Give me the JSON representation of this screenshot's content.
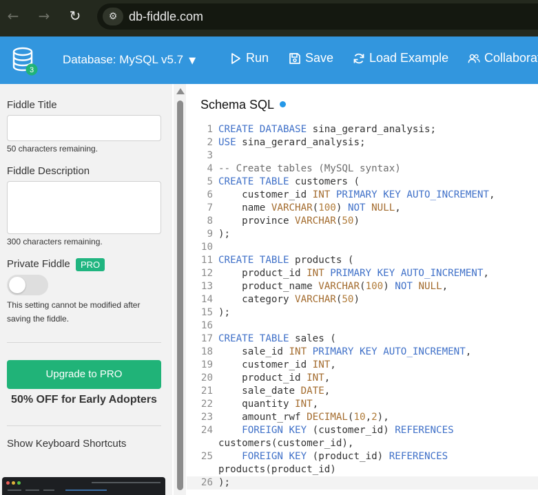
{
  "browser": {
    "url": "db-fiddle.com",
    "back_icon": "←",
    "forward_icon": "→",
    "reload_icon": "↻"
  },
  "header": {
    "badge_count": "3",
    "database_label": "Database: MySQL v5.7",
    "caret": "▼",
    "run_label": "Run",
    "save_label": "Save",
    "load_example_label": "Load Example",
    "collaborate_label": "Collaborat",
    "accent_color": "#3296de"
  },
  "sidebar": {
    "title_label": "Fiddle Title",
    "title_value": "",
    "title_remaining": "50 characters remaining.",
    "description_label": "Fiddle Description",
    "description_value": "",
    "description_remaining": "300 characters remaining.",
    "private_label": "Private Fiddle",
    "pro_badge": "PRO",
    "private_enabled": false,
    "private_note": "This setting cannot be modified after saving the fiddle.",
    "upgrade_label": "Upgrade to PRO",
    "offer_text": "50% OFF for Early Adopters",
    "shortcuts_label": "Show Keyboard Shortcuts",
    "pro_color": "#20b580"
  },
  "editor": {
    "title": "Schema SQL",
    "active_line": "26",
    "lines": [
      {
        "num": "1",
        "tokens": [
          [
            "k",
            "CREATE"
          ],
          [
            "p",
            " "
          ],
          [
            "k",
            "DATABASE"
          ],
          [
            "p",
            " sina_gerard_analysis;"
          ]
        ]
      },
      {
        "num": "2",
        "tokens": [
          [
            "k",
            "USE"
          ],
          [
            "p",
            " sina_gerard_analysis;"
          ]
        ]
      },
      {
        "num": "3",
        "tokens": []
      },
      {
        "num": "4",
        "tokens": [
          [
            "c",
            "-- Create tables (MySQL syntax)"
          ]
        ]
      },
      {
        "num": "5",
        "tokens": [
          [
            "k",
            "CREATE"
          ],
          [
            "p",
            " "
          ],
          [
            "k",
            "TABLE"
          ],
          [
            "p",
            " customers ("
          ]
        ]
      },
      {
        "num": "6",
        "tokens": [
          [
            "p",
            "    customer_id "
          ],
          [
            "t",
            "INT"
          ],
          [
            "p",
            " "
          ],
          [
            "k",
            "PRIMARY"
          ],
          [
            "p",
            " "
          ],
          [
            "k",
            "KEY"
          ],
          [
            "p",
            " "
          ],
          [
            "k",
            "AUTO_INCREMENT"
          ],
          [
            "p",
            ","
          ]
        ]
      },
      {
        "num": "7",
        "tokens": [
          [
            "p",
            "    name "
          ],
          [
            "t",
            "VARCHAR"
          ],
          [
            "p",
            "("
          ],
          [
            "n",
            "100"
          ],
          [
            "p",
            ") "
          ],
          [
            "k",
            "NOT"
          ],
          [
            "p",
            " "
          ],
          [
            "t",
            "NULL"
          ],
          [
            "p",
            ","
          ]
        ]
      },
      {
        "num": "8",
        "tokens": [
          [
            "p",
            "    province "
          ],
          [
            "t",
            "VARCHAR"
          ],
          [
            "p",
            "("
          ],
          [
            "n",
            "50"
          ],
          [
            "p",
            ")"
          ]
        ]
      },
      {
        "num": "9",
        "tokens": [
          [
            "p",
            ");"
          ]
        ]
      },
      {
        "num": "10",
        "tokens": []
      },
      {
        "num": "11",
        "tokens": [
          [
            "k",
            "CREATE"
          ],
          [
            "p",
            " "
          ],
          [
            "k",
            "TABLE"
          ],
          [
            "p",
            " products ("
          ]
        ]
      },
      {
        "num": "12",
        "tokens": [
          [
            "p",
            "    product_id "
          ],
          [
            "t",
            "INT"
          ],
          [
            "p",
            " "
          ],
          [
            "k",
            "PRIMARY"
          ],
          [
            "p",
            " "
          ],
          [
            "k",
            "KEY"
          ],
          [
            "p",
            " "
          ],
          [
            "k",
            "AUTO_INCREMENT"
          ],
          [
            "p",
            ","
          ]
        ]
      },
      {
        "num": "13",
        "tokens": [
          [
            "p",
            "    product_name "
          ],
          [
            "t",
            "VARCHAR"
          ],
          [
            "p",
            "("
          ],
          [
            "n",
            "100"
          ],
          [
            "p",
            ") "
          ],
          [
            "k",
            "NOT"
          ],
          [
            "p",
            " "
          ],
          [
            "t",
            "NULL"
          ],
          [
            "p",
            ","
          ]
        ]
      },
      {
        "num": "14",
        "tokens": [
          [
            "p",
            "    category "
          ],
          [
            "t",
            "VARCHAR"
          ],
          [
            "p",
            "("
          ],
          [
            "n",
            "50"
          ],
          [
            "p",
            ")"
          ]
        ]
      },
      {
        "num": "15",
        "tokens": [
          [
            "p",
            ");"
          ]
        ]
      },
      {
        "num": "16",
        "tokens": []
      },
      {
        "num": "17",
        "tokens": [
          [
            "k",
            "CREATE"
          ],
          [
            "p",
            " "
          ],
          [
            "k",
            "TABLE"
          ],
          [
            "p",
            " sales ("
          ]
        ]
      },
      {
        "num": "18",
        "tokens": [
          [
            "p",
            "    sale_id "
          ],
          [
            "t",
            "INT"
          ],
          [
            "p",
            " "
          ],
          [
            "k",
            "PRIMARY"
          ],
          [
            "p",
            " "
          ],
          [
            "k",
            "KEY"
          ],
          [
            "p",
            " "
          ],
          [
            "k",
            "AUTO_INCREMENT"
          ],
          [
            "p",
            ","
          ]
        ]
      },
      {
        "num": "19",
        "tokens": [
          [
            "p",
            "    customer_id "
          ],
          [
            "t",
            "INT"
          ],
          [
            "p",
            ","
          ]
        ]
      },
      {
        "num": "20",
        "tokens": [
          [
            "p",
            "    product_id "
          ],
          [
            "t",
            "INT"
          ],
          [
            "p",
            ","
          ]
        ]
      },
      {
        "num": "21",
        "tokens": [
          [
            "p",
            "    sale_date "
          ],
          [
            "t",
            "DATE"
          ],
          [
            "p",
            ","
          ]
        ]
      },
      {
        "num": "22",
        "tokens": [
          [
            "p",
            "    quantity "
          ],
          [
            "t",
            "INT"
          ],
          [
            "p",
            ","
          ]
        ]
      },
      {
        "num": "23",
        "tokens": [
          [
            "p",
            "    amount_rwf "
          ],
          [
            "t",
            "DECIMAL"
          ],
          [
            "p",
            "("
          ],
          [
            "n",
            "10"
          ],
          [
            "p",
            ","
          ],
          [
            "n",
            "2"
          ],
          [
            "p",
            "),"
          ]
        ]
      },
      {
        "num": "24",
        "tokens": [
          [
            "p",
            "    "
          ],
          [
            "k",
            "FOREIGN"
          ],
          [
            "p",
            " "
          ],
          [
            "k",
            "KEY"
          ],
          [
            "p",
            " (customer_id) "
          ],
          [
            "k",
            "REFERENCES"
          ]
        ]
      },
      {
        "num": "",
        "tokens": [
          [
            "p",
            "customers(customer_id),"
          ]
        ]
      },
      {
        "num": "25",
        "tokens": [
          [
            "p",
            "    "
          ],
          [
            "k",
            "FOREIGN"
          ],
          [
            "p",
            " "
          ],
          [
            "k",
            "KEY"
          ],
          [
            "p",
            " (product_id) "
          ],
          [
            "k",
            "REFERENCES"
          ]
        ]
      },
      {
        "num": "",
        "tokens": [
          [
            "p",
            "products(product_id)"
          ]
        ]
      },
      {
        "num": "26",
        "tokens": [
          [
            "p",
            ");"
          ]
        ]
      }
    ]
  }
}
